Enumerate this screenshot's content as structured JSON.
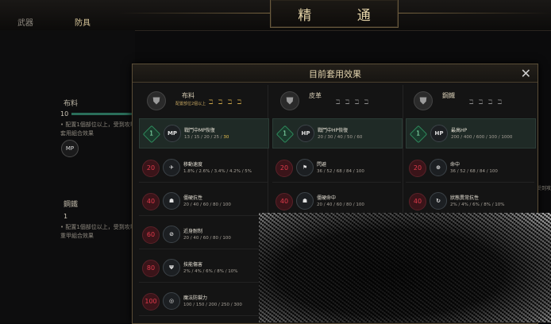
{
  "header": {
    "title": "精 通",
    "tabs": [
      {
        "label": "武器"
      },
      {
        "label": "防具"
      }
    ]
  },
  "left_panel": {
    "section1": {
      "name": "布料",
      "level": "10",
      "line1": "• 配置1個部位以上，受到攻擊時",
      "line2": "套用組合效果"
    },
    "section2": {
      "name": "鋼鐵",
      "level": "1",
      "line1": "• 配置1個部位以上，受到攻擊時",
      "line2": "重甲組合效果"
    },
    "mp_badge": "MP"
  },
  "modal": {
    "title": "目前套用效果",
    "close": "✕",
    "columns": [
      {
        "name": "布料",
        "subtitle": "配置部位2個以上",
        "slots": "ℶ ℶ ℶ ℶ",
        "rows": [
          {
            "level": "1",
            "icon": "MP",
            "name": "戰鬥中MP恢復",
            "values": "13 / 15 / 20 / 25 / ",
            "highlight": "30"
          },
          {
            "level": "20",
            "icon": "✈",
            "name": "移動速度",
            "values": "1.8% / 2.6% / 3.4% / 4.2% / 5%"
          },
          {
            "level": "40",
            "icon": "☗",
            "name": "僵硬抗性",
            "values": "20 / 40 / 60 / 80 / 100"
          },
          {
            "level": "60",
            "icon": "⊘",
            "name": "近身耐制",
            "values": "20 / 40 / 60 / 80 / 100"
          },
          {
            "level": "80",
            "icon": "Ψ",
            "name": "技能傷害",
            "values": "2% / 4% / 6% / 8% / 10%"
          },
          {
            "level": "100",
            "icon": "◎",
            "name": "魔法防禦力",
            "values": "100 / 150 / 200 / 250 / 300"
          }
        ]
      },
      {
        "name": "皮革",
        "subtitle": "",
        "slots": "ℶ ℶ ℶ ℶ",
        "rows": [
          {
            "level": "1",
            "icon": "HP",
            "name": "戰鬥中HP恢復",
            "values": "20 / 30 / 40 / 50 / 60"
          },
          {
            "level": "20",
            "icon": "⚑",
            "name": "閃避",
            "values": "36 / 52 / 68 / 84 / 100"
          },
          {
            "level": "40",
            "icon": "☗",
            "name": "僵硬命中",
            "values": "20 / 40 / 60 / 80 / 100"
          },
          {
            "level": "60",
            "icon": "⊘",
            "name": "",
            "values": ""
          }
        ]
      },
      {
        "name": "鋼鐵",
        "subtitle": "",
        "slots": "ℶ ℶ ℶ ℶ",
        "rows": [
          {
            "level": "1",
            "icon": "HP",
            "name": "最高HP",
            "values": "200 / 400 / 600 / 100 / 1000"
          },
          {
            "level": "20",
            "icon": "⊕",
            "name": "命中",
            "values": "36 / 52 / 68 / 84 / 100"
          },
          {
            "level": "40",
            "icon": "↻",
            "name": "狀態異常抗性",
            "values": "2% / 4% / 6% / 8% / 10%"
          }
        ]
      }
    ]
  },
  "right_edge_text": "受到攻"
}
